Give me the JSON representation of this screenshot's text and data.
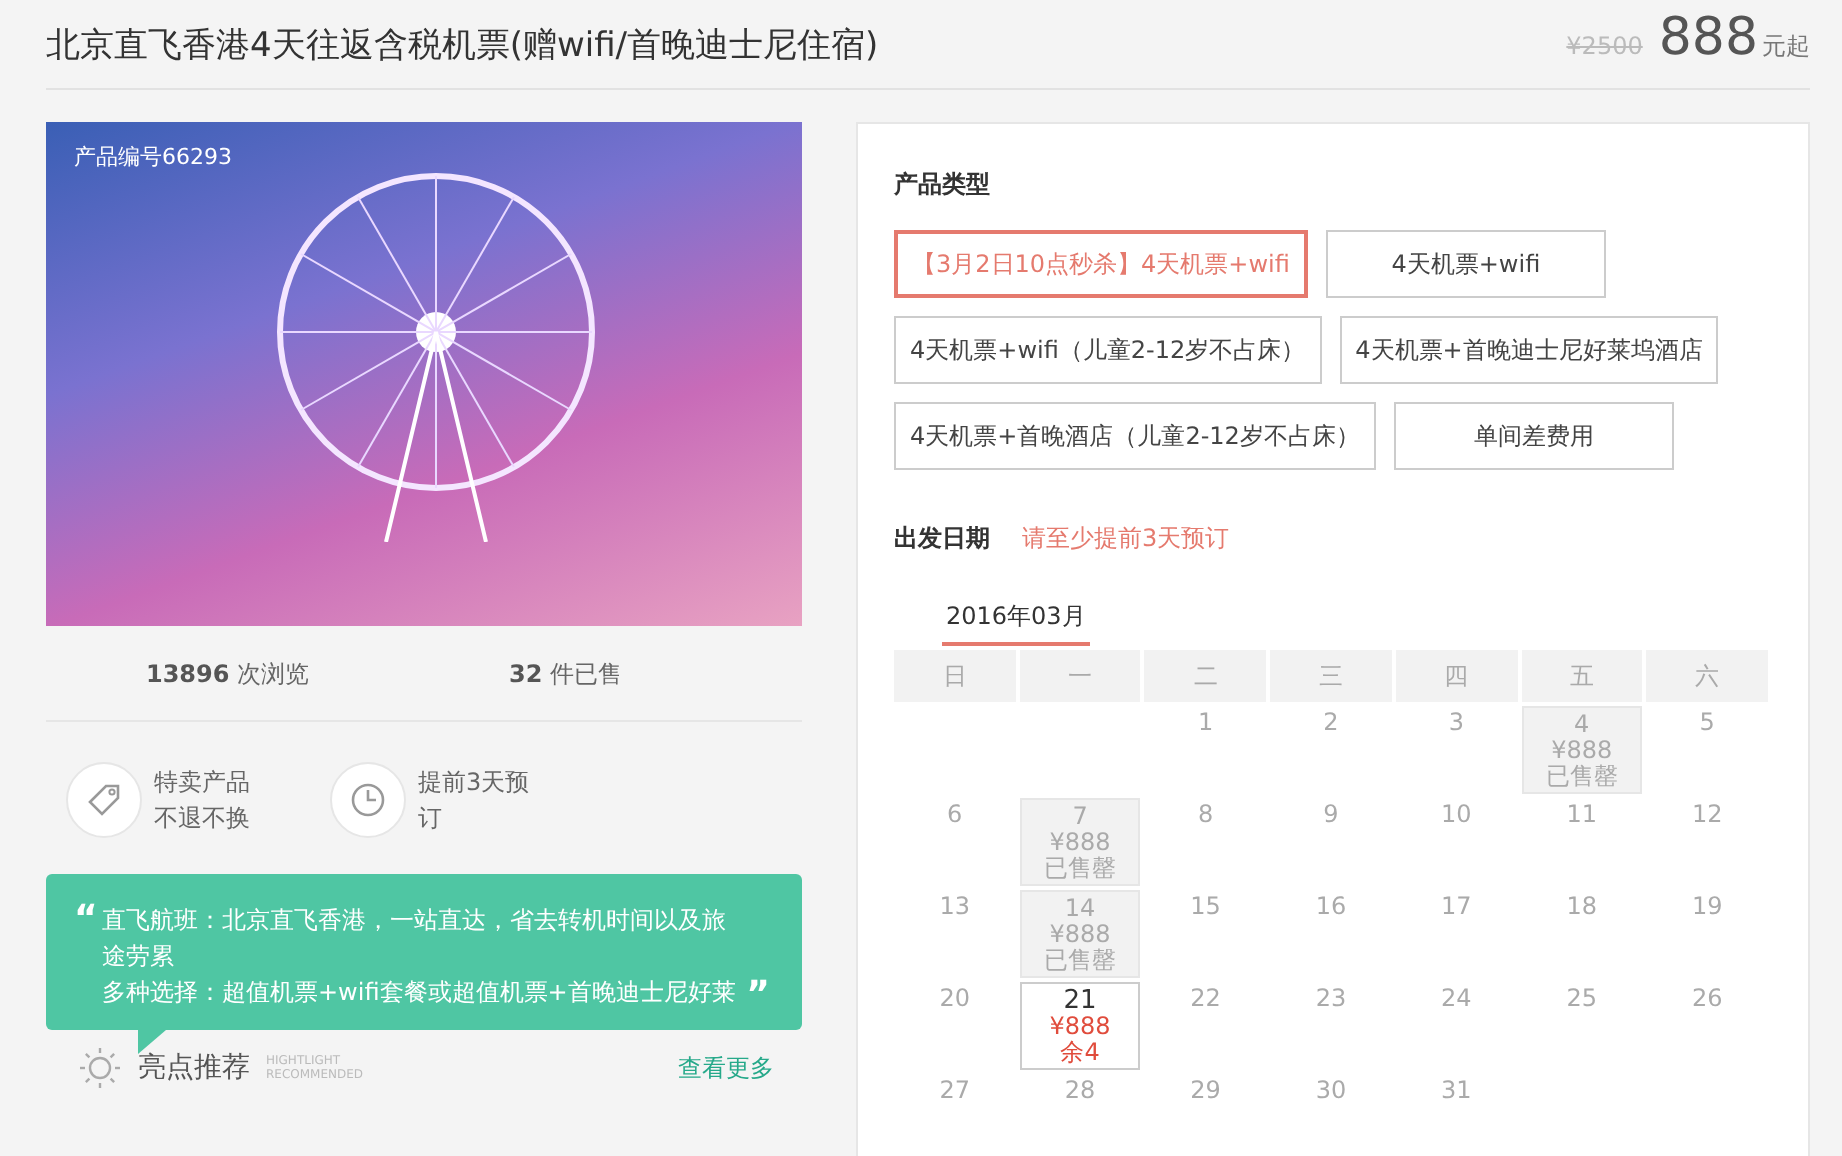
{
  "header": {
    "title": "北京直飞香港4天往返含税机票(赠wifi/首晚迪士尼住宿)",
    "original_price": "¥2500",
    "price": "888",
    "price_suffix": "元起"
  },
  "product": {
    "photo_badge": "产品编号66293",
    "stats": [
      {
        "number": "13896",
        "label": "次浏览"
      },
      {
        "number": "32",
        "label": "件已售"
      }
    ],
    "features": [
      {
        "kind": "tag",
        "lines": [
          "特卖产品",
          "不退不换"
        ]
      },
      {
        "kind": "clock",
        "lines": [
          "提前3天预",
          "订"
        ]
      }
    ],
    "highlight": {
      "lines": [
        "直飞航班：北京直飞香港，一站直达，省去转机时间以及旅途劳累",
        "多种选择：超值机票+wifi套餐或超值机票+首晚迪士尼好莱"
      ],
      "open_quote": "“",
      "close_quote": "”",
      "label": "亮点推荐",
      "label_en": [
        "HIGHTLIGHT",
        "RECOMMENDED"
      ],
      "more": "查看更多"
    }
  },
  "booking": {
    "type_title": "产品类型",
    "types": [
      {
        "label": "【3月2日10点秒杀】4天机票+wifi",
        "selected": true
      },
      {
        "label": "4天机票+wifi",
        "selected": false
      },
      {
        "label": "4天机票+wifi（儿童2-12岁不占床）",
        "selected": false
      },
      {
        "label": "4天机票+首晚迪士尼好莱坞酒店",
        "selected": false
      },
      {
        "label": "4天机票+首晚酒店（儿童2-12岁不占床）",
        "selected": false
      },
      {
        "label": "单间差费用",
        "selected": false
      }
    ],
    "date_title": "出发日期",
    "date_hint": "请至少提前3天预订",
    "months": [
      {
        "label": "2016年03月",
        "selected": true
      }
    ],
    "weekdays": [
      "日",
      "一",
      "二",
      "三",
      "四",
      "五",
      "六"
    ],
    "weeks": [
      [
        {
          "kind": "blank"
        },
        {
          "kind": "blank"
        },
        {
          "kind": "plain",
          "day": "1"
        },
        {
          "kind": "plain",
          "day": "2"
        },
        {
          "kind": "plain",
          "day": "3"
        },
        {
          "kind": "soldout",
          "day": "4",
          "price": "¥888",
          "note": "已售罄"
        },
        {
          "kind": "plain",
          "day": "5"
        }
      ],
      [
        {
          "kind": "plain",
          "day": "6"
        },
        {
          "kind": "soldout",
          "day": "7",
          "price": "¥888",
          "note": "已售罄"
        },
        {
          "kind": "plain",
          "day": "8"
        },
        {
          "kind": "plain",
          "day": "9"
        },
        {
          "kind": "plain",
          "day": "10"
        },
        {
          "kind": "plain",
          "day": "11"
        },
        {
          "kind": "plain",
          "day": "12"
        }
      ],
      [
        {
          "kind": "plain",
          "day": "13"
        },
        {
          "kind": "soldout",
          "day": "14",
          "price": "¥888",
          "note": "已售罄"
        },
        {
          "kind": "plain",
          "day": "15"
        },
        {
          "kind": "plain",
          "day": "16"
        },
        {
          "kind": "plain",
          "day": "17"
        },
        {
          "kind": "plain",
          "day": "18"
        },
        {
          "kind": "plain",
          "day": "19"
        }
      ],
      [
        {
          "kind": "plain",
          "day": "20"
        },
        {
          "kind": "open",
          "day": "21",
          "price": "¥888",
          "note": "余4"
        },
        {
          "kind": "plain",
          "day": "22"
        },
        {
          "kind": "plain",
          "day": "23"
        },
        {
          "kind": "plain",
          "day": "24"
        },
        {
          "kind": "plain",
          "day": "25"
        },
        {
          "kind": "plain",
          "day": "26"
        }
      ],
      [
        {
          "kind": "plain",
          "day": "27"
        },
        {
          "kind": "plain",
          "day": "28"
        },
        {
          "kind": "plain",
          "day": "29"
        },
        {
          "kind": "plain",
          "day": "30"
        },
        {
          "kind": "plain",
          "day": "31"
        },
        {
          "kind": "blank"
        },
        {
          "kind": "blank"
        }
      ]
    ]
  }
}
